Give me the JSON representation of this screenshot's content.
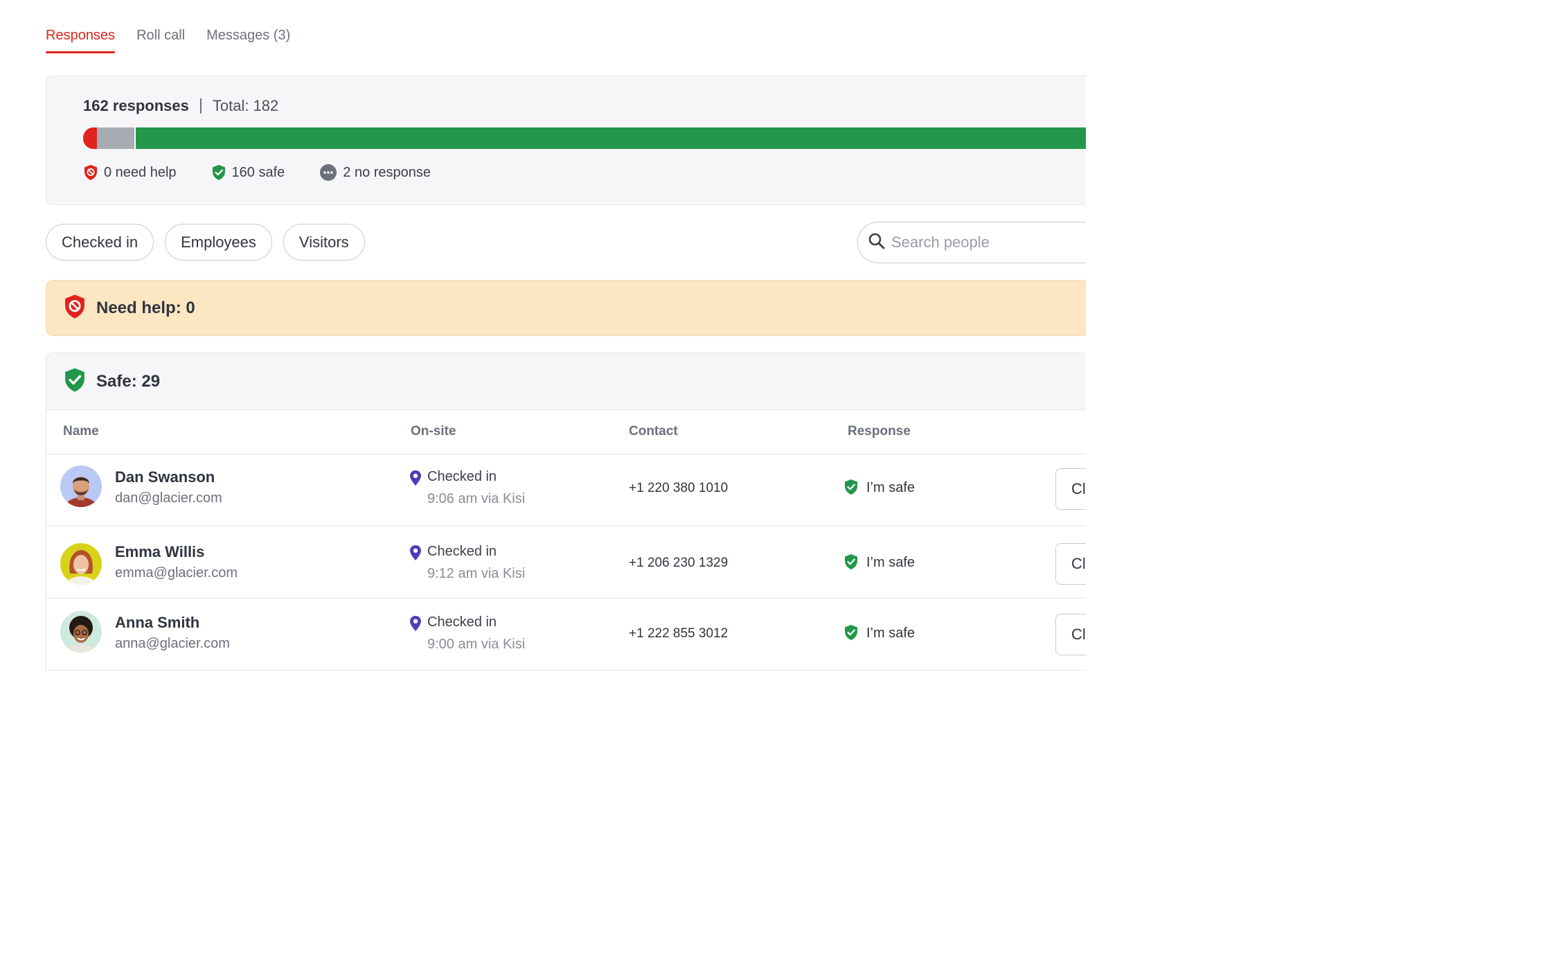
{
  "tabs": [
    {
      "label": "Responses",
      "active": true
    },
    {
      "label": "Roll call",
      "active": false
    },
    {
      "label": "Messages (3)",
      "active": false
    }
  ],
  "summary": {
    "responses_label": "162 responses",
    "total_label": "Total: 182",
    "bar": {
      "need_help": 0,
      "no_response": 2,
      "safe": 160
    },
    "legend": {
      "need_help": "0 need help",
      "safe": "160 safe",
      "no_response": "2 no response"
    }
  },
  "filters": [
    "Checked in",
    "Employees",
    "Visitors"
  ],
  "search": {
    "placeholder": "Search people"
  },
  "need_help_section": {
    "title": "Need help: 0"
  },
  "safe_section": {
    "title": "Safe: 29",
    "columns": {
      "name": "Name",
      "onsite": "On-site",
      "contact": "Contact",
      "response": "Response"
    },
    "rows": [
      {
        "name": "Dan Swanson",
        "email": "dan@glacier.com",
        "onsite_status": "Checked in",
        "onsite_time": "9:06 am via Kisi",
        "contact": "+1 220 380 1010",
        "response": "I’m safe",
        "action": "Cl"
      },
      {
        "name": "Emma Willis",
        "email": "emma@glacier.com",
        "onsite_status": "Checked in",
        "onsite_time": "9:12 am via Kisi",
        "contact": "+1 206 230 1329",
        "response": "I’m safe",
        "action": "Cl"
      },
      {
        "name": "Anna Smith",
        "email": "anna@glacier.com",
        "onsite_status": "Checked in",
        "onsite_time": "9:00 am via Kisi",
        "contact": "+1 222 855 3012",
        "response": "I’m safe",
        "action": "Cl"
      }
    ]
  },
  "colors": {
    "accent": "#e0231c",
    "safe": "#22974b",
    "no_response": "#a9abb3",
    "banner": "#fde6c2",
    "pin": "#4a3fb8"
  }
}
